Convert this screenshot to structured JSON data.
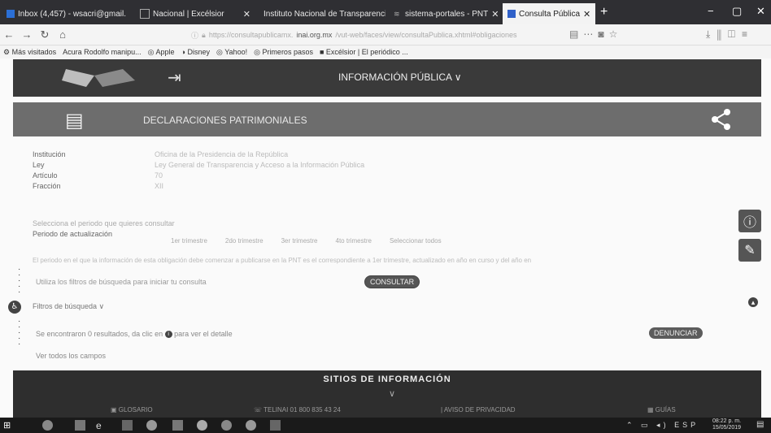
{
  "browser": {
    "tabs": [
      {
        "title": "Inbox (4,457) - wsacri@gmail.",
        "color": "#2b6fd6"
      },
      {
        "title": "Nacional | Excélsior",
        "color": "#4a4a4a"
      },
      {
        "title": "Instituto Nacional de Transparencia",
        "color": "#4a4a4a"
      },
      {
        "title": "sistema-portales - PNT",
        "color": "#4a4a4a"
      },
      {
        "title": "Consulta Pública",
        "color": "#3061c9"
      }
    ],
    "url_prefix": "https://consultapublicamx.",
    "url_host": "inai.org.mx",
    "url_suffix": "/vut-web/faces/view/consultaPublica.xhtml#obligaciones",
    "bookmarks": [
      "Más visitados",
      "Acura Rodolfo manipu...",
      "Apple",
      "Disney",
      "Yahoo!",
      "Primeros pasos",
      "Excélsior | El periódico ..."
    ]
  },
  "header": {
    "title": "INFORMACIÓN PÚBLICA ∨"
  },
  "section": {
    "title": "DECLARACIONES PATRIMONIALES"
  },
  "details": [
    {
      "label": "Institución",
      "value": "Oficina de la Presidencia de la República"
    },
    {
      "label": "Ley",
      "value": "Ley General de Transparencia y Acceso a la Información Pública"
    },
    {
      "label": "Artículo",
      "value": "70"
    },
    {
      "label": "Fracción",
      "value": "XII"
    }
  ],
  "period": {
    "question": "Selecciona el periodo que quieres consultar",
    "label": "Periodo de actualización",
    "options": [
      "1er trimestre",
      "2do trimestre",
      "3er trimestre",
      "4to trimestre",
      "Seleccionar todos"
    ]
  },
  "notice": "El periodo en el que la información de esta obligación debe comenzar a publicarse en la PNT es el correspondiente a 1er trimestre, actualizado en año en curso y del año en",
  "filter_help": "Utiliza los filtros de búsqueda para iniciar tu consulta",
  "consultar_label": "CONSULTAR",
  "filtros_label": "Filtros de búsqueda ∨",
  "results": {
    "prefix": "Se encontraron 0 resultados, da clic en",
    "suffix": "para ver el detalle",
    "info_glyph": "i"
  },
  "denunciar_label": "DENUNCIAR",
  "ver_todos": "Ver todos los campos",
  "footer": {
    "title": "SITIOS DE INFORMACIÓN",
    "items": [
      "GLOSARIO",
      "TELINAI 01 800 835 43 24",
      "AVISO DE PRIVACIDAD",
      "GUÍAS"
    ]
  },
  "taskbar": {
    "time": "08:22 p. m.",
    "date": "15/05/2019",
    "lang": "ESP"
  }
}
